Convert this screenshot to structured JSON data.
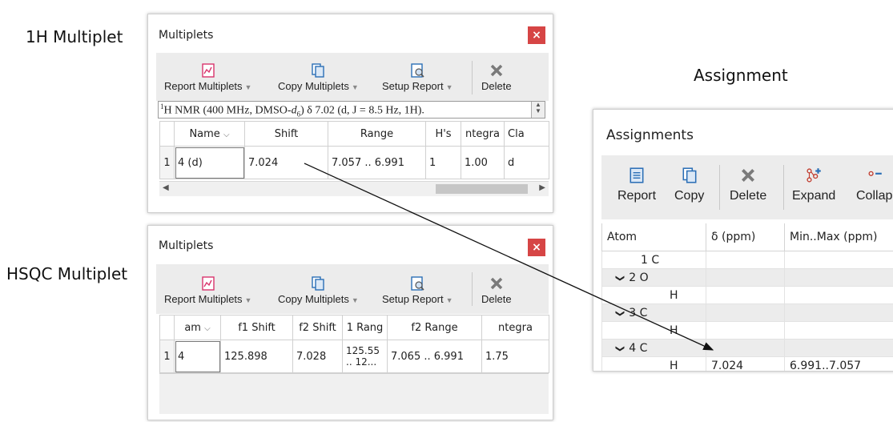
{
  "captions": {
    "h1": "1H Multiplet",
    "hsqc": "HSQC Multiplet",
    "assignment": "Assignment"
  },
  "multiplets_top": {
    "title": "Multiplets",
    "close": "×",
    "toolbar": {
      "report": "Report Multiplets",
      "copy": "Copy Multiplets",
      "setup": "Setup Report",
      "delete": "Delete"
    },
    "report_text_pre": "H NMR (400 MHz, DMSO-",
    "report_sup": "1",
    "report_sub": "6",
    "report_d": "d",
    "report_text_post": ") δ 7.02 (d, J = 8.5 Hz, 1H).",
    "columns": [
      "Name",
      "Shift",
      "Range",
      "H's",
      "ntegra",
      "Cla"
    ],
    "rows": [
      {
        "n": "1",
        "name": "4 (d)",
        "shift": "7.024",
        "range": "7.057 .. 6.991",
        "hs": "1",
        "integral": "1.00",
        "cls": "d"
      }
    ]
  },
  "multiplets_bottom": {
    "title": "Multiplets",
    "close": "×",
    "toolbar": {
      "report": "Report Multiplets",
      "copy": "Copy Multiplets",
      "setup": "Setup Report",
      "delete": "Delete"
    },
    "columns": [
      "am",
      "f1 Shift",
      "f2 Shift",
      "1 Rang",
      "f2 Range",
      "ntegra"
    ],
    "rows": [
      {
        "n": "1",
        "name": "4",
        "f1": "125.898",
        "f2": "7.028",
        "r1a": "125.55",
        "r1b": ".. 12...",
        "r2": "7.065 .. 6.991",
        "integral": "1.75"
      }
    ]
  },
  "assignments": {
    "title": "Assignments",
    "toolbar": {
      "report": "Report",
      "copy": "Copy",
      "delete": "Delete",
      "expand": "Expand",
      "collapse": "Collap"
    },
    "columns": [
      "Atom",
      "δ (ppm)",
      "Min..Max (ppm)"
    ],
    "rows": [
      {
        "chev": "",
        "atom": "1 C",
        "shift": "",
        "range": "",
        "group": false,
        "indent": 1
      },
      {
        "chev": "❯",
        "atom": "2 O",
        "shift": "",
        "range": "",
        "group": true,
        "indent": 0
      },
      {
        "chev": "",
        "atom": "H",
        "shift": "",
        "range": "",
        "group": false,
        "indent": 2
      },
      {
        "chev": "❯",
        "atom": "3 C",
        "shift": "",
        "range": "",
        "group": true,
        "indent": 0
      },
      {
        "chev": "",
        "atom": "H",
        "shift": "",
        "range": "",
        "group": false,
        "indent": 2
      },
      {
        "chev": "❯",
        "atom": "4 C",
        "shift": "",
        "range": "",
        "group": true,
        "indent": 0
      },
      {
        "chev": "",
        "atom": "H",
        "shift": "7.024",
        "range": "6.991..7.057",
        "group": false,
        "indent": 2
      }
    ]
  },
  "colors": {
    "close_red": "#d64545",
    "report_icon": "#d9346d",
    "copy_icon": "#2b6fb6",
    "delete_icon": "#7a7a7a",
    "expand_icon": "#c0392b",
    "arrow": "#111111"
  }
}
